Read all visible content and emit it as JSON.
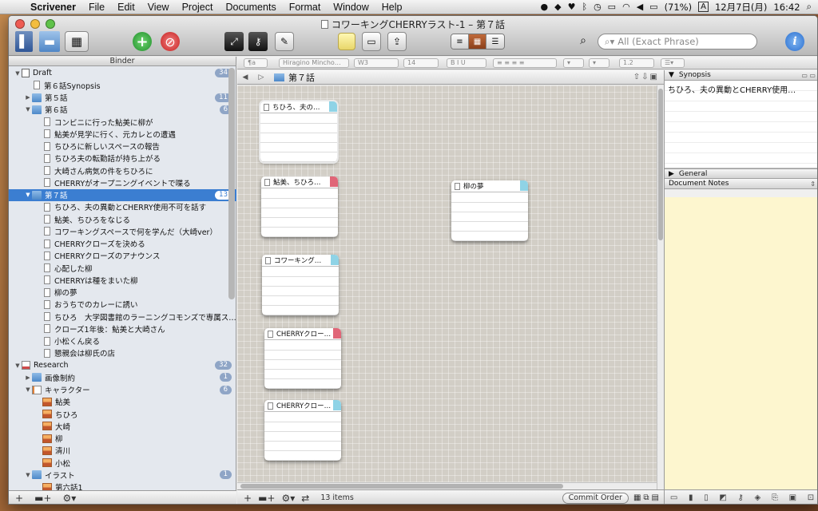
{
  "menubar": {
    "app": "Scrivener",
    "items": [
      "File",
      "Edit",
      "View",
      "Project",
      "Documents",
      "Format",
      "Window",
      "Help"
    ],
    "battery": "(71%)",
    "input": "A",
    "date": "12月7日(月)",
    "time": "16:42"
  },
  "window": {
    "title": "コワーキングCHERRYラスト-1 – 第７話"
  },
  "toolbar": {
    "search_placeholder": "All (Exact Phrase)",
    "info": "i"
  },
  "binder": {
    "title": "Binder",
    "rows": [
      {
        "label": "Draft",
        "indent": 0,
        "tri": "▼",
        "icon": "draft",
        "badge": "34"
      },
      {
        "label": "第６話Synopsis",
        "indent": 1,
        "tri": "",
        "icon": "doc",
        "badge": ""
      },
      {
        "label": "第５話",
        "indent": 1,
        "tri": "▶",
        "icon": "fold",
        "badge": "11"
      },
      {
        "label": "第６話",
        "indent": 1,
        "tri": "▼",
        "icon": "fold",
        "badge": "6"
      },
      {
        "label": "コンビニに行った鮎美に柳が",
        "indent": 2,
        "tri": "",
        "icon": "doc",
        "badge": ""
      },
      {
        "label": "鮎美が見学に行く、元カレとの遭遇",
        "indent": 2,
        "tri": "",
        "icon": "doc",
        "badge": ""
      },
      {
        "label": "ちひろに新しいスペースの報告",
        "indent": 2,
        "tri": "",
        "icon": "doc",
        "badge": ""
      },
      {
        "label": "ちひろ夫の転勤話が持ち上がる",
        "indent": 2,
        "tri": "",
        "icon": "doc",
        "badge": ""
      },
      {
        "label": "大崎さん病気の件をちひろに",
        "indent": 2,
        "tri": "",
        "icon": "doc",
        "badge": ""
      },
      {
        "label": "CHERRYがオープニングイベントで喋る",
        "indent": 2,
        "tri": "",
        "icon": "doc",
        "badge": ""
      },
      {
        "label": "第７話",
        "indent": 1,
        "tri": "▼",
        "icon": "fold",
        "badge": "13",
        "selected": true
      },
      {
        "label": "ちひろ、夫の異動とCHERRY使用不可を話す",
        "indent": 2,
        "tri": "",
        "icon": "doc",
        "badge": ""
      },
      {
        "label": "鮎美、ちひろをなじる",
        "indent": 2,
        "tri": "",
        "icon": "doc",
        "badge": ""
      },
      {
        "label": "コワーキングスペースで何を学んだ（大崎ver）",
        "indent": 2,
        "tri": "",
        "icon": "doc",
        "badge": ""
      },
      {
        "label": "CHERRYクローズを決める",
        "indent": 2,
        "tri": "",
        "icon": "doc",
        "badge": ""
      },
      {
        "label": "CHERRYクローズのアナウンス",
        "indent": 2,
        "tri": "",
        "icon": "doc",
        "badge": ""
      },
      {
        "label": "心配した柳",
        "indent": 2,
        "tri": "",
        "icon": "doc",
        "badge": ""
      },
      {
        "label": "CHERRYは種をまいた柳",
        "indent": 2,
        "tri": "",
        "icon": "doc",
        "badge": ""
      },
      {
        "label": "柳の夢",
        "indent": 2,
        "tri": "",
        "icon": "doc",
        "badge": ""
      },
      {
        "label": "おうちでのカレーに誘い",
        "indent": 2,
        "tri": "",
        "icon": "doc",
        "badge": ""
      },
      {
        "label": "ちひろ　大学図書館のラーニングコモンズで専属ス…",
        "indent": 2,
        "tri": "",
        "icon": "doc",
        "badge": ""
      },
      {
        "label": "クローズ1年後：鮎美と大崎さん",
        "indent": 2,
        "tri": "",
        "icon": "doc",
        "badge": ""
      },
      {
        "label": "小松くん戻る",
        "indent": 2,
        "tri": "",
        "icon": "doc",
        "badge": ""
      },
      {
        "label": "懇親会は柳氏の店",
        "indent": 2,
        "tri": "",
        "icon": "doc",
        "badge": ""
      },
      {
        "label": "Research",
        "indent": 0,
        "tri": "▼",
        "icon": "research",
        "badge": "32"
      },
      {
        "label": "画像制約",
        "indent": 1,
        "tri": "▶",
        "icon": "fold",
        "badge": "1"
      },
      {
        "label": "キャラクター",
        "indent": 1,
        "tri": "▼",
        "icon": "bookdoc",
        "badge": "6"
      },
      {
        "label": "鮎美",
        "indent": 2,
        "tri": "",
        "icon": "pic",
        "badge": ""
      },
      {
        "label": "ちひろ",
        "indent": 2,
        "tri": "",
        "icon": "pic",
        "badge": ""
      },
      {
        "label": "大崎",
        "indent": 2,
        "tri": "",
        "icon": "pic",
        "badge": ""
      },
      {
        "label": "柳",
        "indent": 2,
        "tri": "",
        "icon": "pic",
        "badge": ""
      },
      {
        "label": "清川",
        "indent": 2,
        "tri": "",
        "icon": "pic",
        "badge": ""
      },
      {
        "label": "小松",
        "indent": 2,
        "tri": "",
        "icon": "pic",
        "badge": ""
      },
      {
        "label": "イラスト",
        "indent": 1,
        "tri": "▼",
        "icon": "fold",
        "badge": "1"
      },
      {
        "label": "第六話1",
        "indent": 2,
        "tri": "",
        "icon": "pic",
        "badge": ""
      }
    ]
  },
  "formatbar": {
    "style": "¶a",
    "font": "Hiragino Mincho…",
    "weight": "W3",
    "size": "14",
    "line": "1.2"
  },
  "corkboard": {
    "path": "第７話",
    "cards": [
      {
        "title": "ちひろ、夫の…",
        "tag": "#8fd3e6"
      },
      {
        "title": "鮎美、ちひろ…",
        "tag": "#e06678"
      },
      {
        "title": "コワーキング…",
        "tag": "#8fd3e6"
      },
      {
        "title": "CHERRYクロー…",
        "tag": "#e06678"
      },
      {
        "title": "CHERRYクロー…",
        "tag": "#8fd3e6"
      },
      {
        "title": "柳の夢",
        "tag": "#8fd3e6"
      }
    ],
    "count": "13 items",
    "commit": "Commit Order"
  },
  "inspector": {
    "synopsis_label": "Synopsis",
    "synopsis_text": "ちひろ、夫の異動とCHERRY使用…",
    "general_label": "General",
    "notes_label": "Document Notes"
  }
}
